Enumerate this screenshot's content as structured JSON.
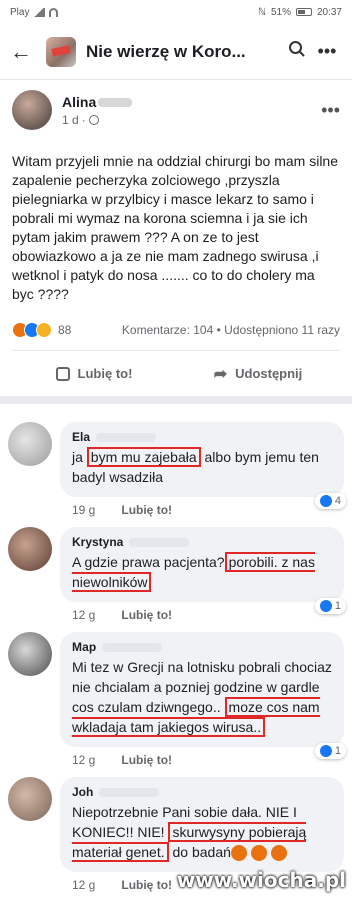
{
  "status_bar": {
    "carrier": "Play",
    "battery": "51%",
    "time": "20:37"
  },
  "header": {
    "title": "Nie wierzę w Koro..."
  },
  "post": {
    "author": "Alina",
    "time": "1 d",
    "text": "Witam przyjeli mnie na oddzial chirurgi bo mam silne zapalenie pecherzyka zolciowego ,przyszla pielegniarka w przylbicy i masce lekarz to samo i pobrali  mi wymaz na korona sciemna i ja sie ich pytam jakim prawem ??? A on ze to jest obowiazkowo a ja ze nie mam zadnego swirusa ,i wetknol i patyk do nosa ....... co to do  cholery ma byc ????",
    "reaction_count": "88",
    "counts": "Komentarze: 104 • Udostępniono 11 razy",
    "like_label": "Lubię to!",
    "share_label": "Udostępnij"
  },
  "comments": [
    {
      "name": "Ela",
      "segments": [
        {
          "t": "ja ",
          "hl": false
        },
        {
          "t": "bym mu zajebała",
          "hl": true
        },
        {
          "t": " albo bym jemu ten badyl wsadziła",
          "hl": false
        }
      ],
      "time": "19 g",
      "like": "Lubię to!",
      "reactions": "4"
    },
    {
      "name": "Krystyna",
      "segments": [
        {
          "t": "A gdzie prawa pacjenta?",
          "hl": false
        },
        {
          "t": "porobili. z nas niewolników",
          "hl": true
        }
      ],
      "time": "12 g",
      "like": "Lubię to!",
      "reactions": "1"
    },
    {
      "name": "Мар",
      "segments": [
        {
          "t": "Mi tez w Grecji na lotnisku pobrali chociaz nie chcialam a pozniej godzine w gardle cos czulam dziwngego.. ",
          "hl": false
        },
        {
          "t": "moze cos nam wkladaja tam jakiegos wirusa..",
          "hl": true
        }
      ],
      "time": "12 g",
      "like": "Lubię to!",
      "reactions": "1"
    },
    {
      "name": "Joh",
      "segments": [
        {
          "t": "Niepotrzebnie Pani sobie dała. NIE I KONIEC!! NIE! ",
          "hl": false
        },
        {
          "t": "skurwysyny pobierają materiał genet.",
          "hl": true
        },
        {
          "t": " do badań",
          "hl": false
        }
      ],
      "time": "12 g",
      "like": "Lubię to!",
      "reactions": ""
    }
  ],
  "watermark": "www.wiocha.pl",
  "colors": {
    "highlight": "#e02828",
    "fb_blue": "#1877f2",
    "bubble": "#f0f2f5"
  }
}
